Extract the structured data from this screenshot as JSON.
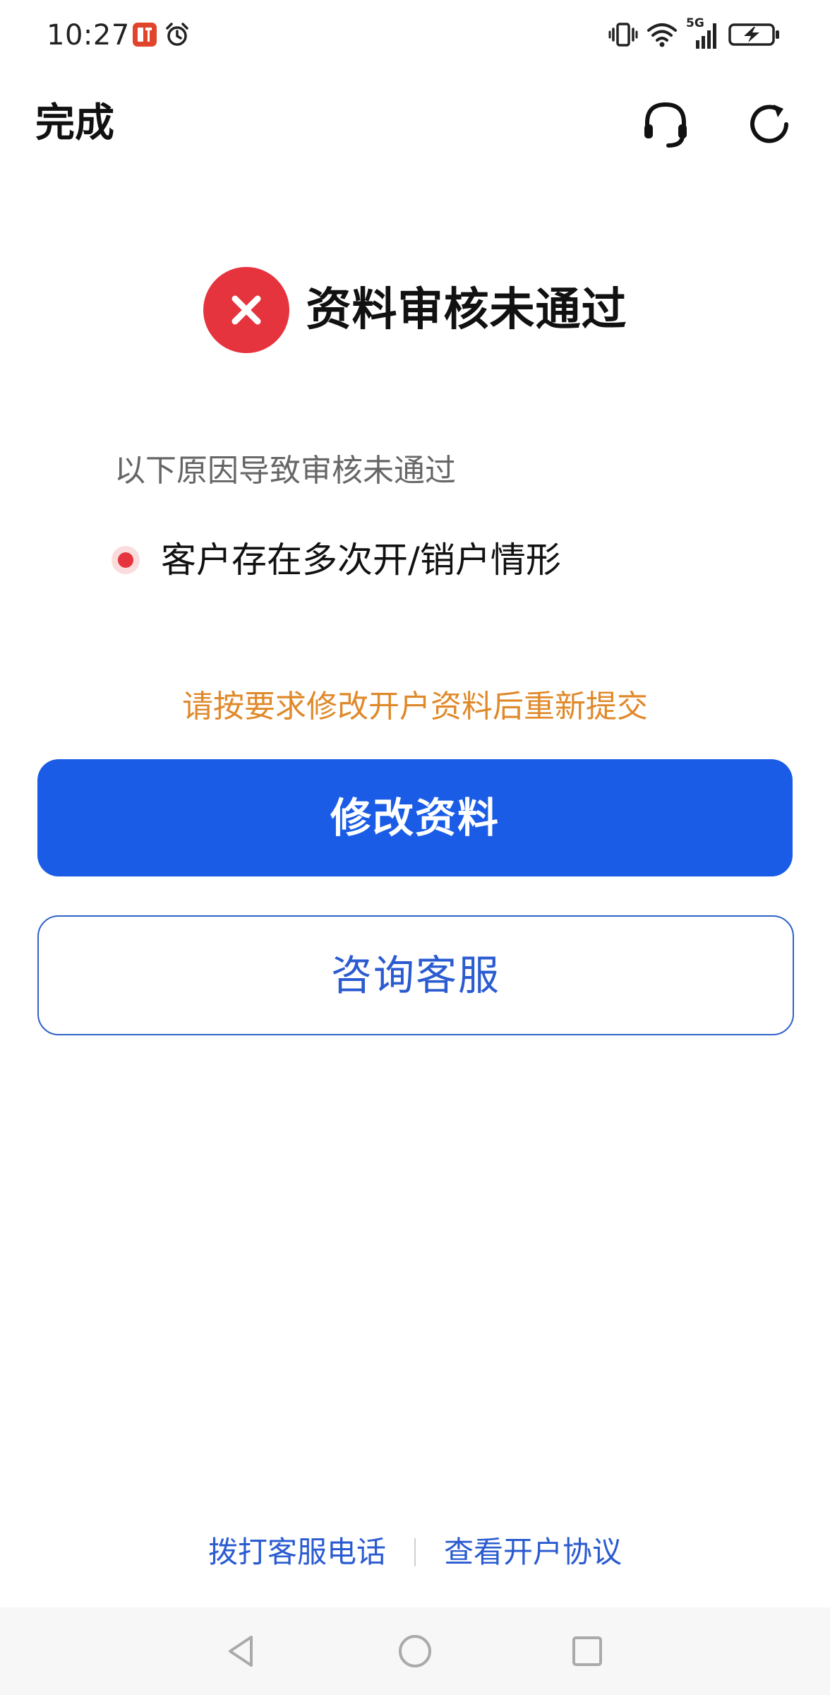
{
  "status_bar": {
    "time": "10:27",
    "network_label": "5G",
    "icons": [
      "app-notification-icon",
      "alarm-icon",
      "vibrate-icon",
      "wifi-icon",
      "cellular-signal-icon",
      "battery-charging-icon"
    ]
  },
  "header": {
    "done_label": "完成",
    "icons": [
      "headset-icon",
      "refresh-icon"
    ]
  },
  "result": {
    "title": "资料审核未通过",
    "icon": "error-circle-icon"
  },
  "reasons": {
    "heading": "以下原因导致审核未通过",
    "items": [
      {
        "text": "客户存在多次开/销户情形"
      }
    ]
  },
  "hint": "请按要求修改开户资料后重新提交",
  "buttons": {
    "edit_label": "修改资料",
    "consult_label": "咨询客服"
  },
  "footer": {
    "call_label": "拨打客服电话",
    "agreement_label": "查看开户协议"
  },
  "colors": {
    "primary": "#1a5ce6",
    "error": "#e5343e",
    "warning_text": "#e0892a",
    "link": "#2a5bd0"
  },
  "nav_bar": {
    "icons": [
      "back-icon",
      "home-icon",
      "recent-apps-icon"
    ]
  }
}
